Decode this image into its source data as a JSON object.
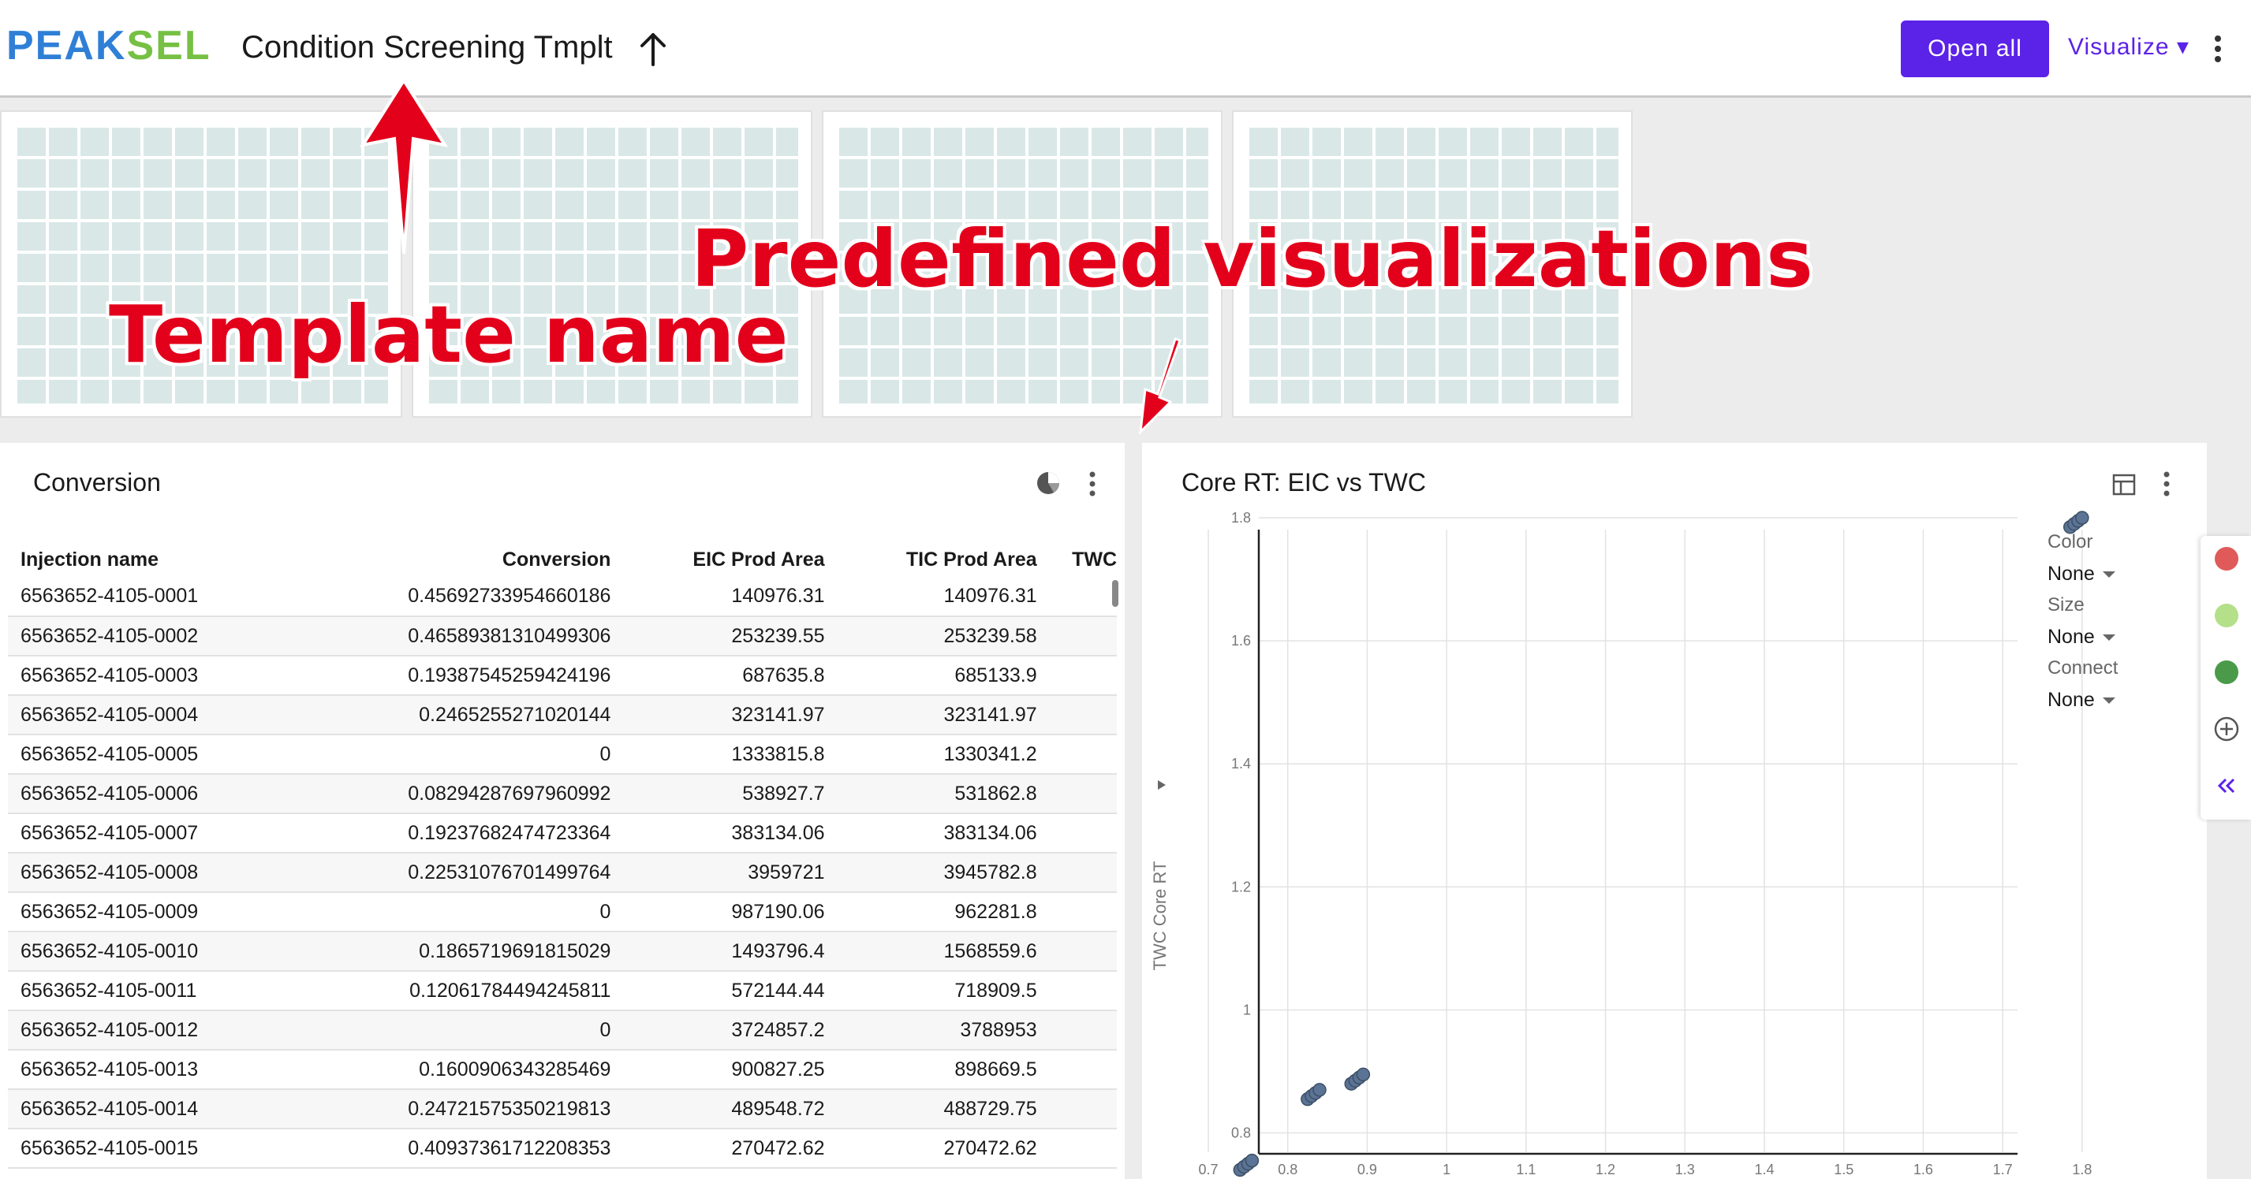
{
  "header": {
    "logo_part1": "PEAK",
    "logo_part2": "SEL",
    "title": "Condition Screening Tmplt",
    "open_all_label": "Open all",
    "visualize_label": "Visualize ▾"
  },
  "annotations": {
    "template_name": "Template name",
    "predefined_visualizations": "Predefined visualizations"
  },
  "conversion_panel": {
    "title": "Conversion",
    "columns": [
      "Injection name",
      "Conversion",
      "EIC Prod Area",
      "TIC Prod Area",
      "TWC"
    ],
    "rows": [
      [
        "6563652-4105-0001",
        "0.45692733954660186",
        "140976.31",
        "140976.31",
        ""
      ],
      [
        "6563652-4105-0002",
        "0.46589381310499306",
        "253239.55",
        "253239.58",
        ""
      ],
      [
        "6563652-4105-0003",
        "0.19387545259424196",
        "687635.8",
        "685133.9",
        ""
      ],
      [
        "6563652-4105-0004",
        "0.2465255271020144",
        "323141.97",
        "323141.97",
        ""
      ],
      [
        "6563652-4105-0005",
        "0",
        "1333815.8",
        "1330341.2",
        ""
      ],
      [
        "6563652-4105-0006",
        "0.08294287697960992",
        "538927.7",
        "531862.8",
        ""
      ],
      [
        "6563652-4105-0007",
        "0.19237682474723364",
        "383134.06",
        "383134.06",
        ""
      ],
      [
        "6563652-4105-0008",
        "0.22531076701499764",
        "3959721",
        "3945782.8",
        ""
      ],
      [
        "6563652-4105-0009",
        "0",
        "987190.06",
        "962281.8",
        ""
      ],
      [
        "6563652-4105-0010",
        "0.1865719691815029",
        "1493796.4",
        "1568559.6",
        ""
      ],
      [
        "6563652-4105-0011",
        "0.12061784494245811",
        "572144.44",
        "718909.5",
        ""
      ],
      [
        "6563652-4105-0012",
        "0",
        "3724857.2",
        "3788953",
        ""
      ],
      [
        "6563652-4105-0013",
        "0.1600906343285469",
        "900827.25",
        "898669.5",
        ""
      ],
      [
        "6563652-4105-0014",
        "0.24721575350219813",
        "489548.72",
        "488729.75",
        ""
      ],
      [
        "6563652-4105-0015",
        "0.40937361712208353",
        "270472.62",
        "270472.62",
        ""
      ]
    ]
  },
  "scatter_panel": {
    "title": "Core RT: EIC vs TWC",
    "controls": {
      "color_label": "Color",
      "color_value": "None",
      "size_label": "Size",
      "size_value": "None",
      "connect_label": "Connect",
      "connect_value": "None"
    }
  },
  "side_strip": {
    "dot_colors": [
      "#e05a5a",
      "#b4e08a",
      "#4a9a4a"
    ],
    "icons": [
      "plus-circle-icon",
      "double-chevron-left-icon"
    ]
  },
  "chart_data": {
    "type": "scatter",
    "title": "Core RT: EIC vs TWC",
    "xlabel": "",
    "ylabel": "TWC Core RT",
    "xlim": [
      0.7,
      1.82
    ],
    "ylim": [
      0.72,
      1.85
    ],
    "x_ticks": [
      "0.7",
      "0.8",
      "0.9",
      "1",
      "1.1",
      "1.2",
      "1.3",
      "1.4",
      "1.5",
      "1.6",
      "1.7",
      "1.8"
    ],
    "y_ticks": [
      "0.8",
      "1",
      "1.2",
      "1.4",
      "1.6",
      "1.8"
    ],
    "grid": true,
    "points": [
      {
        "x": 0.74,
        "y": 0.74
      },
      {
        "x": 0.745,
        "y": 0.745
      },
      {
        "x": 0.75,
        "y": 0.75
      },
      {
        "x": 0.755,
        "y": 0.755
      },
      {
        "x": 0.825,
        "y": 0.855
      },
      {
        "x": 0.83,
        "y": 0.86
      },
      {
        "x": 0.835,
        "y": 0.865
      },
      {
        "x": 0.84,
        "y": 0.87
      },
      {
        "x": 0.88,
        "y": 0.88
      },
      {
        "x": 0.885,
        "y": 0.885
      },
      {
        "x": 0.89,
        "y": 0.89
      },
      {
        "x": 0.895,
        "y": 0.895
      },
      {
        "x": 1.785,
        "y": 1.785
      },
      {
        "x": 1.79,
        "y": 1.79
      },
      {
        "x": 1.795,
        "y": 1.795
      },
      {
        "x": 1.8,
        "y": 1.8
      }
    ],
    "marker_color": "#5b7394"
  }
}
